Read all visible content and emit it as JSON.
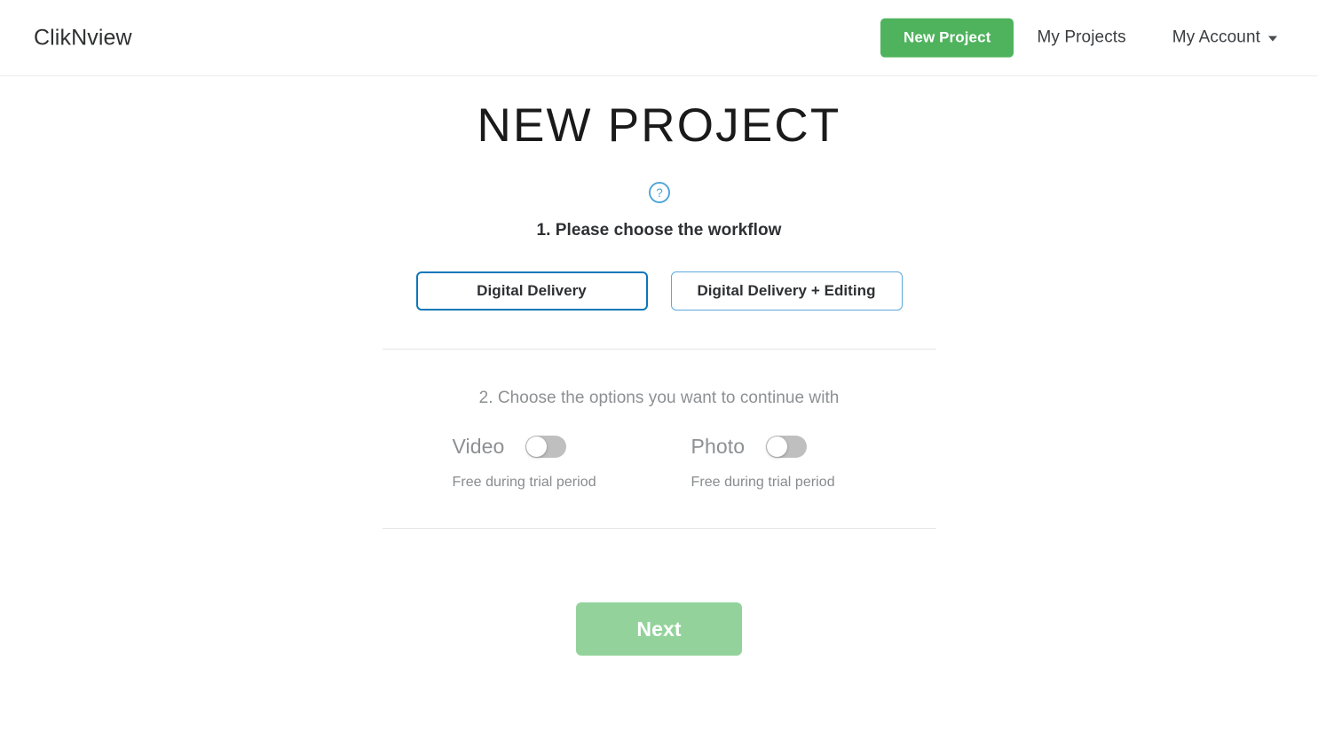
{
  "header": {
    "brand": "ClikNview",
    "new_project_button": "New Project",
    "my_projects_link": "My Projects",
    "my_account_link": "My Account",
    "caret_icon": "chevron-down-icon",
    "accent_green": "#4fb35d"
  },
  "main": {
    "page_title": "NEW PROJECT",
    "help_icon": "help-circle-icon",
    "help_icon_color": "#4ba3d8",
    "step1": {
      "label": "1. Please choose the workflow",
      "options": [
        {
          "label": "Digital Delivery",
          "focused": true
        },
        {
          "label": "Digital Delivery + Editing",
          "focused": false
        }
      ],
      "border_color": "#5aa9dd",
      "focus_border_color": "#0d77b8"
    },
    "step2": {
      "label": "2. Choose the options you want to continue with",
      "label_color": "#8d9093",
      "options": [
        {
          "label": "Video",
          "note": "Free during trial period",
          "enabled": false
        },
        {
          "label": "Photo",
          "note": "Free during trial period",
          "enabled": false
        }
      ]
    },
    "next_button": {
      "label": "Next",
      "color": "#93d39b",
      "disabled": true
    }
  }
}
